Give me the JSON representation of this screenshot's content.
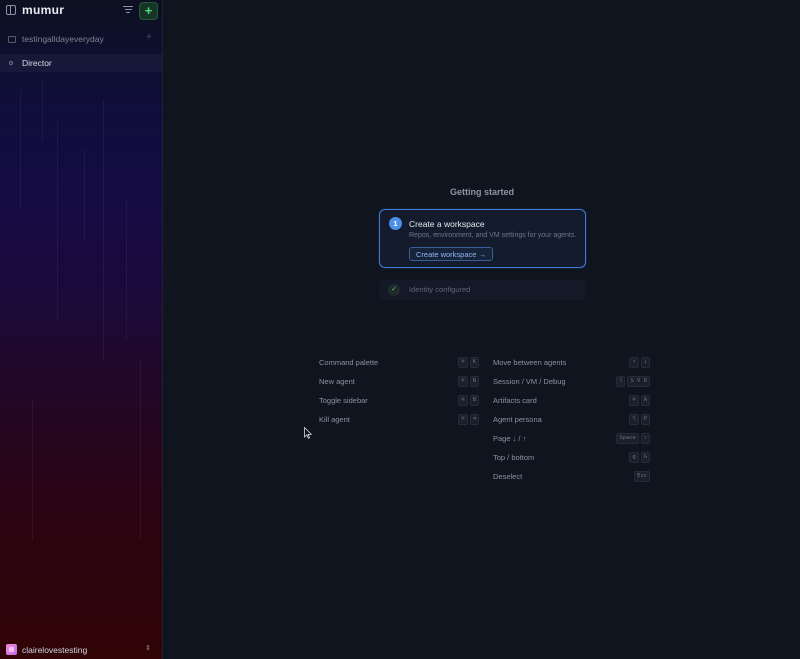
{
  "sidebar": {
    "logo": "mumur",
    "new_label": "+",
    "workspace": {
      "name": "testingalldayeveryday",
      "add_label": "+"
    },
    "agents": [
      {
        "name": "Director"
      }
    ],
    "user": {
      "name": "clairelovestesting",
      "chevron": "⇕"
    }
  },
  "main": {
    "getting_started_title": "Getting started",
    "step1": {
      "number": "1",
      "title": "Create a workspace",
      "description": "Repos, environment, and VM settings for your agents.",
      "button_label": "Create workspace →"
    },
    "step2": {
      "check": "✓",
      "label": "Identity configured"
    },
    "shortcuts_left": [
      {
        "label": "Command palette",
        "keys": [
          "⌘",
          "K"
        ]
      },
      {
        "label": "New agent",
        "keys": [
          "⌘",
          "N"
        ]
      },
      {
        "label": "Toggle sidebar",
        "keys": [
          "⌘",
          "B"
        ]
      },
      {
        "label": "Kill agent",
        "keys": [
          "⌘",
          "⌫"
        ]
      }
    ],
    "shortcuts_right": [
      {
        "label": "Move between agents",
        "keys": [
          "↑",
          "↓"
        ]
      },
      {
        "label": "Session / VM / Debug",
        "keys": [
          "⌥",
          "S V D"
        ]
      },
      {
        "label": "Artifacts card",
        "keys": [
          "⌘",
          "A"
        ]
      },
      {
        "label": "Agent persona",
        "keys": [
          "⌥",
          "P"
        ]
      },
      {
        "label": "Page ↓ / ↑",
        "keys": [
          "Space",
          "⇧"
        ]
      },
      {
        "label": "Top / bottom",
        "keys": [
          "g",
          "G"
        ]
      },
      {
        "label": "Deselect",
        "keys": [
          "Esc"
        ]
      }
    ]
  },
  "colors": {
    "accent_blue": "#4c8eea",
    "new_button_green": "#4bdc7e",
    "background": "#10141f"
  }
}
